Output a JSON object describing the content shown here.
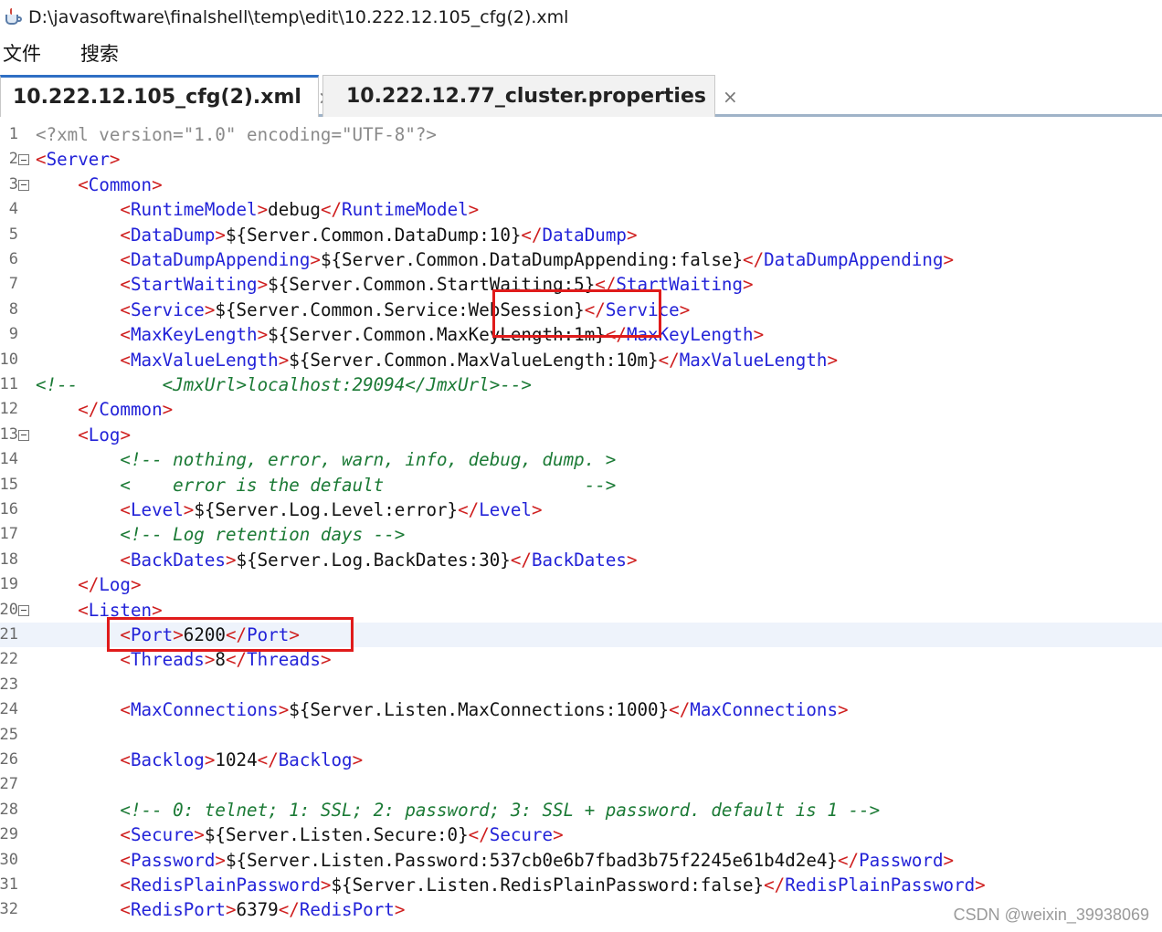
{
  "window": {
    "title": "D:\\javasoftware\\finalshell\\temp\\edit\\10.222.12.105_cfg(2).xml"
  },
  "menu": {
    "file": "文件",
    "search": "搜索"
  },
  "tabs": [
    {
      "label": "10.222.12.105_cfg(2).xml",
      "close": "×",
      "active": true
    },
    {
      "label": "10.222.12.77_cluster.properties",
      "close": "×",
      "active": false
    }
  ],
  "editor": {
    "current_line": 21,
    "lines": [
      {
        "n": "1",
        "fold": false,
        "spans": [
          [
            "xd",
            "<?xml version=\"1.0\" encoding=\"UTF-8\"?>"
          ]
        ]
      },
      {
        "n": "2",
        "fold": true,
        "spans": [
          [
            "b",
            "<"
          ],
          [
            "t",
            "Server"
          ],
          [
            "b",
            ">"
          ]
        ]
      },
      {
        "n": "3",
        "fold": true,
        "spans": [
          [
            "x",
            "    "
          ],
          [
            "b",
            "<"
          ],
          [
            "t",
            "Common"
          ],
          [
            "b",
            ">"
          ]
        ]
      },
      {
        "n": "4",
        "fold": false,
        "spans": [
          [
            "x",
            "        "
          ],
          [
            "b",
            "<"
          ],
          [
            "t",
            "RuntimeModel"
          ],
          [
            "b",
            ">"
          ],
          [
            "x",
            "debug"
          ],
          [
            "b",
            "</"
          ],
          [
            "t",
            "RuntimeModel"
          ],
          [
            "b",
            ">"
          ]
        ]
      },
      {
        "n": "5",
        "fold": false,
        "spans": [
          [
            "x",
            "        "
          ],
          [
            "b",
            "<"
          ],
          [
            "t",
            "DataDump"
          ],
          [
            "b",
            ">"
          ],
          [
            "x",
            "${Server.Common.DataDump:10}"
          ],
          [
            "b",
            "</"
          ],
          [
            "t",
            "DataDump"
          ],
          [
            "b",
            ">"
          ]
        ]
      },
      {
        "n": "6",
        "fold": false,
        "spans": [
          [
            "x",
            "        "
          ],
          [
            "b",
            "<"
          ],
          [
            "t",
            "DataDumpAppending"
          ],
          [
            "b",
            ">"
          ],
          [
            "x",
            "${Server.Common.DataDumpAppending:false}"
          ],
          [
            "b",
            "</"
          ],
          [
            "t",
            "DataDumpAppending"
          ],
          [
            "b",
            ">"
          ]
        ]
      },
      {
        "n": "7",
        "fold": false,
        "spans": [
          [
            "x",
            "        "
          ],
          [
            "b",
            "<"
          ],
          [
            "t",
            "StartWaiting"
          ],
          [
            "b",
            ">"
          ],
          [
            "x",
            "${Server.Common.StartWaiting:5}"
          ],
          [
            "b",
            "</"
          ],
          [
            "t",
            "StartWaiting"
          ],
          [
            "b",
            ">"
          ]
        ]
      },
      {
        "n": "8",
        "fold": false,
        "spans": [
          [
            "x",
            "        "
          ],
          [
            "b",
            "<"
          ],
          [
            "t",
            "Service"
          ],
          [
            "b",
            ">"
          ],
          [
            "x",
            "${Server.Common.Service:WebSession}"
          ],
          [
            "b",
            "</"
          ],
          [
            "t",
            "Service"
          ],
          [
            "b",
            ">"
          ]
        ]
      },
      {
        "n": "9",
        "fold": false,
        "spans": [
          [
            "x",
            "        "
          ],
          [
            "b",
            "<"
          ],
          [
            "t",
            "MaxKeyLength"
          ],
          [
            "b",
            ">"
          ],
          [
            "x",
            "${Server.Common.MaxKeyLength:1m}"
          ],
          [
            "b",
            "</"
          ],
          [
            "t",
            "MaxKeyLength"
          ],
          [
            "b",
            ">"
          ]
        ]
      },
      {
        "n": "10",
        "fold": false,
        "spans": [
          [
            "x",
            "        "
          ],
          [
            "b",
            "<"
          ],
          [
            "t",
            "MaxValueLength"
          ],
          [
            "b",
            ">"
          ],
          [
            "x",
            "${Server.Common.MaxValueLength:10m}"
          ],
          [
            "b",
            "</"
          ],
          [
            "t",
            "MaxValueLength"
          ],
          [
            "b",
            ">"
          ]
        ]
      },
      {
        "n": "11",
        "fold": false,
        "spans": [
          [
            "c",
            "<!--        <JmxUrl>localhost:29094</JmxUrl>-->"
          ]
        ]
      },
      {
        "n": "12",
        "fold": false,
        "spans": [
          [
            "x",
            "    "
          ],
          [
            "b",
            "</"
          ],
          [
            "t",
            "Common"
          ],
          [
            "b",
            ">"
          ]
        ]
      },
      {
        "n": "13",
        "fold": true,
        "spans": [
          [
            "x",
            "    "
          ],
          [
            "b",
            "<"
          ],
          [
            "t",
            "Log"
          ],
          [
            "b",
            ">"
          ]
        ]
      },
      {
        "n": "14",
        "fold": false,
        "spans": [
          [
            "x",
            "        "
          ],
          [
            "c",
            "<!-- nothing, error, warn, info, debug, dump. >"
          ]
        ]
      },
      {
        "n": "15",
        "fold": false,
        "spans": [
          [
            "x",
            "        "
          ],
          [
            "c",
            "<    error is the default                   -->"
          ]
        ]
      },
      {
        "n": "16",
        "fold": false,
        "spans": [
          [
            "x",
            "        "
          ],
          [
            "b",
            "<"
          ],
          [
            "t",
            "Level"
          ],
          [
            "b",
            ">"
          ],
          [
            "x",
            "${Server.Log.Level:error}"
          ],
          [
            "b",
            "</"
          ],
          [
            "t",
            "Level"
          ],
          [
            "b",
            ">"
          ]
        ]
      },
      {
        "n": "17",
        "fold": false,
        "spans": [
          [
            "x",
            "        "
          ],
          [
            "c",
            "<!-- Log retention days -->"
          ]
        ]
      },
      {
        "n": "18",
        "fold": false,
        "spans": [
          [
            "x",
            "        "
          ],
          [
            "b",
            "<"
          ],
          [
            "t",
            "BackDates"
          ],
          [
            "b",
            ">"
          ],
          [
            "x",
            "${Server.Log.BackDates:30}"
          ],
          [
            "b",
            "</"
          ],
          [
            "t",
            "BackDates"
          ],
          [
            "b",
            ">"
          ]
        ]
      },
      {
        "n": "19",
        "fold": false,
        "spans": [
          [
            "x",
            "    "
          ],
          [
            "b",
            "</"
          ],
          [
            "t",
            "Log"
          ],
          [
            "b",
            ">"
          ]
        ]
      },
      {
        "n": "20",
        "fold": true,
        "spans": [
          [
            "x",
            "    "
          ],
          [
            "b",
            "<"
          ],
          [
            "t",
            "Listen"
          ],
          [
            "b",
            ">"
          ]
        ]
      },
      {
        "n": "21",
        "fold": false,
        "spans": [
          [
            "x",
            "        "
          ],
          [
            "b",
            "<"
          ],
          [
            "t",
            "Port"
          ],
          [
            "b",
            ">"
          ],
          [
            "x",
            "6200"
          ],
          [
            "b",
            "</"
          ],
          [
            "t",
            "Port"
          ],
          [
            "b",
            ">"
          ]
        ]
      },
      {
        "n": "22",
        "fold": false,
        "spans": [
          [
            "x",
            "        "
          ],
          [
            "b",
            "<"
          ],
          [
            "t",
            "Threads"
          ],
          [
            "b",
            ">"
          ],
          [
            "x",
            "8"
          ],
          [
            "b",
            "</"
          ],
          [
            "t",
            "Threads"
          ],
          [
            "b",
            ">"
          ]
        ]
      },
      {
        "n": "23",
        "fold": false,
        "spans": []
      },
      {
        "n": "24",
        "fold": false,
        "spans": [
          [
            "x",
            "        "
          ],
          [
            "b",
            "<"
          ],
          [
            "t",
            "MaxConnections"
          ],
          [
            "b",
            ">"
          ],
          [
            "x",
            "${Server.Listen.MaxConnections:1000}"
          ],
          [
            "b",
            "</"
          ],
          [
            "t",
            "MaxConnections"
          ],
          [
            "b",
            ">"
          ]
        ]
      },
      {
        "n": "25",
        "fold": false,
        "spans": []
      },
      {
        "n": "26",
        "fold": false,
        "spans": [
          [
            "x",
            "        "
          ],
          [
            "b",
            "<"
          ],
          [
            "t",
            "Backlog"
          ],
          [
            "b",
            ">"
          ],
          [
            "x",
            "1024"
          ],
          [
            "b",
            "</"
          ],
          [
            "t",
            "Backlog"
          ],
          [
            "b",
            ">"
          ]
        ]
      },
      {
        "n": "27",
        "fold": false,
        "spans": []
      },
      {
        "n": "28",
        "fold": false,
        "spans": [
          [
            "x",
            "        "
          ],
          [
            "c",
            "<!-- 0: telnet; 1: SSL; 2: password; 3: SSL + password. default is 1 -->"
          ]
        ]
      },
      {
        "n": "29",
        "fold": false,
        "spans": [
          [
            "x",
            "        "
          ],
          [
            "b",
            "<"
          ],
          [
            "t",
            "Secure"
          ],
          [
            "b",
            ">"
          ],
          [
            "x",
            "${Server.Listen.Secure:0}"
          ],
          [
            "b",
            "</"
          ],
          [
            "t",
            "Secure"
          ],
          [
            "b",
            ">"
          ]
        ]
      },
      {
        "n": "30",
        "fold": false,
        "spans": [
          [
            "x",
            "        "
          ],
          [
            "b",
            "<"
          ],
          [
            "t",
            "Password"
          ],
          [
            "b",
            ">"
          ],
          [
            "x",
            "${Server.Listen.Password:537cb0e6b7fbad3b75f2245e61b4d2e4}"
          ],
          [
            "b",
            "</"
          ],
          [
            "t",
            "Password"
          ],
          [
            "b",
            ">"
          ]
        ]
      },
      {
        "n": "31",
        "fold": false,
        "spans": [
          [
            "x",
            "        "
          ],
          [
            "b",
            "<"
          ],
          [
            "t",
            "RedisPlainPassword"
          ],
          [
            "b",
            ">"
          ],
          [
            "x",
            "${Server.Listen.RedisPlainPassword:false}"
          ],
          [
            "b",
            "</"
          ],
          [
            "t",
            "RedisPlainPassword"
          ],
          [
            "b",
            ">"
          ]
        ]
      },
      {
        "n": "32",
        "fold": false,
        "spans": [
          [
            "x",
            "        "
          ],
          [
            "b",
            "<"
          ],
          [
            "t",
            "RedisPort"
          ],
          [
            "b",
            ">"
          ],
          [
            "x",
            "6379"
          ],
          [
            "b",
            "</"
          ],
          [
            "t",
            "RedisPort"
          ],
          [
            "b",
            ">"
          ]
        ]
      }
    ]
  },
  "watermark": "CSDN @weixin_39938069"
}
